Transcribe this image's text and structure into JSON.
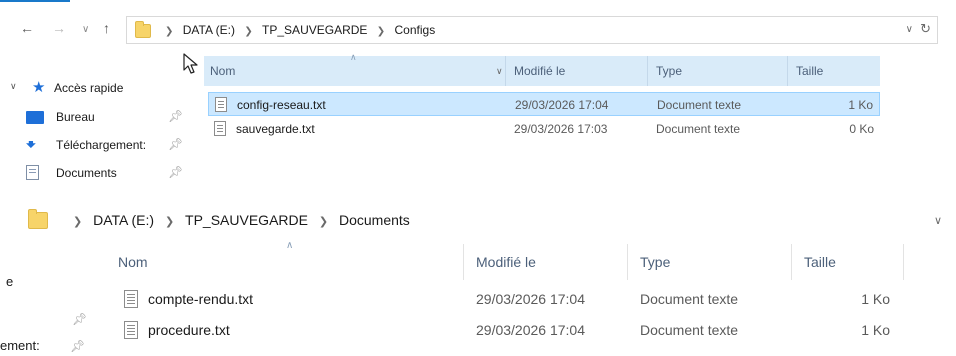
{
  "colors": {
    "accent": "#1979ca",
    "header_bg": "#d9ebf9",
    "selected_row": "#cce8ff",
    "folder": "#f7d469"
  },
  "window1": {
    "nav": {
      "back_icon": "arrow-left-icon",
      "forward_icon": "arrow-right-icon",
      "up_icon": "arrow-up-icon"
    },
    "breadcrumb": [
      "DATA (E:)",
      "TP_SAUVEGARDE",
      "Configs"
    ],
    "sidebar": {
      "quick_access": "Accès rapide",
      "items": [
        {
          "label": "Bureau",
          "icon": "desktop-icon"
        },
        {
          "label": "Téléchargement:",
          "icon": "download-icon"
        },
        {
          "label": "Documents",
          "icon": "documents-icon"
        }
      ]
    },
    "columns": [
      "Nom",
      "Modifié le",
      "Type",
      "Taille"
    ],
    "files": [
      {
        "name": "config-reseau.txt",
        "modified": "29/03/2026 17:04",
        "type": "Document texte",
        "size": "1 Ko",
        "selected": true
      },
      {
        "name": "sauvegarde.txt",
        "modified": "29/03/2026 17:03",
        "type": "Document texte",
        "size": "0 Ko",
        "selected": false
      }
    ]
  },
  "window2": {
    "breadcrumb": [
      "DATA (E:)",
      "TP_SAUVEGARDE",
      "Documents"
    ],
    "sidebar_fragments": [
      "e",
      "ement:"
    ],
    "columns": [
      "Nom",
      "Modifié le",
      "Type",
      "Taille"
    ],
    "files": [
      {
        "name": "compte-rendu.txt",
        "modified": "29/03/2026 17:04",
        "type": "Document texte",
        "size": "1 Ko"
      },
      {
        "name": "procedure.txt",
        "modified": "29/03/2026 17:04",
        "type": "Document texte",
        "size": "1 Ko"
      }
    ]
  }
}
